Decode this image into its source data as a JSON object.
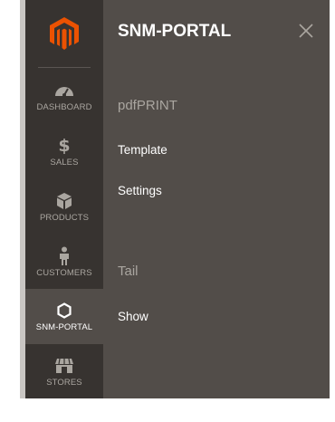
{
  "sidebar": {
    "logo_icon": "magento-logo-icon",
    "items": [
      {
        "id": "dashboard",
        "label": "DASHBOARD",
        "icon": "speedometer-icon"
      },
      {
        "id": "sales",
        "label": "SALES",
        "icon": "dollar-icon",
        "glyph": "$"
      },
      {
        "id": "products",
        "label": "PRODUCTS",
        "icon": "cube-icon"
      },
      {
        "id": "customers",
        "label": "CUSTOMERS",
        "icon": "person-icon"
      },
      {
        "id": "snm-portal",
        "label": "SNM-PORTAL",
        "icon": "hexagon-icon",
        "active": true
      },
      {
        "id": "stores",
        "label": "STORES",
        "icon": "storefront-icon"
      }
    ]
  },
  "panel": {
    "title": "SNM-PORTAL",
    "close_icon": "close-icon",
    "sections": [
      {
        "title": "pdfPRINT",
        "links": [
          "Template",
          "Settings"
        ]
      },
      {
        "title": "Tail",
        "links": [
          "Show"
        ]
      }
    ]
  },
  "colors": {
    "sidebar_bg": "#373330",
    "panel_bg": "#524d49",
    "active_bg": "#524d49",
    "brand_orange": "#eb5202",
    "muted_text": "#aaa6a0",
    "text": "#ffffff"
  }
}
